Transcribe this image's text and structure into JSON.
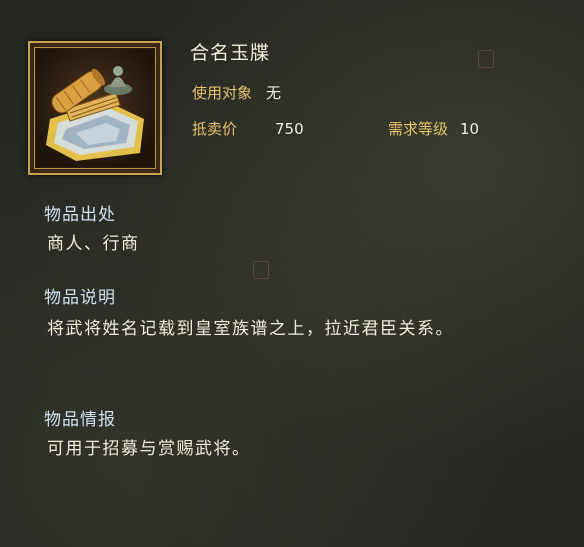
{
  "item": {
    "name": "合名玉牒",
    "target_label": "使用对象",
    "target_value": "无",
    "price_label": "抵卖价",
    "price_value": "750",
    "level_label": "需求等级",
    "level_value": "10"
  },
  "sections": {
    "source": {
      "heading": "物品出处",
      "text": "商人、行商"
    },
    "desc": {
      "heading": "物品说明",
      "text": "将武将姓名记载到皇室族谱之上，拉近君臣关系。"
    },
    "info": {
      "heading": "物品情报",
      "text": "可用于招募与赏赐武将。"
    }
  },
  "colors": {
    "label": "#e8c16a",
    "heading": "#cfe0f0",
    "text": "#f2ecd9",
    "frame": "#c9a34e"
  },
  "icons": [
    "jade-register-scroll-icon"
  ]
}
